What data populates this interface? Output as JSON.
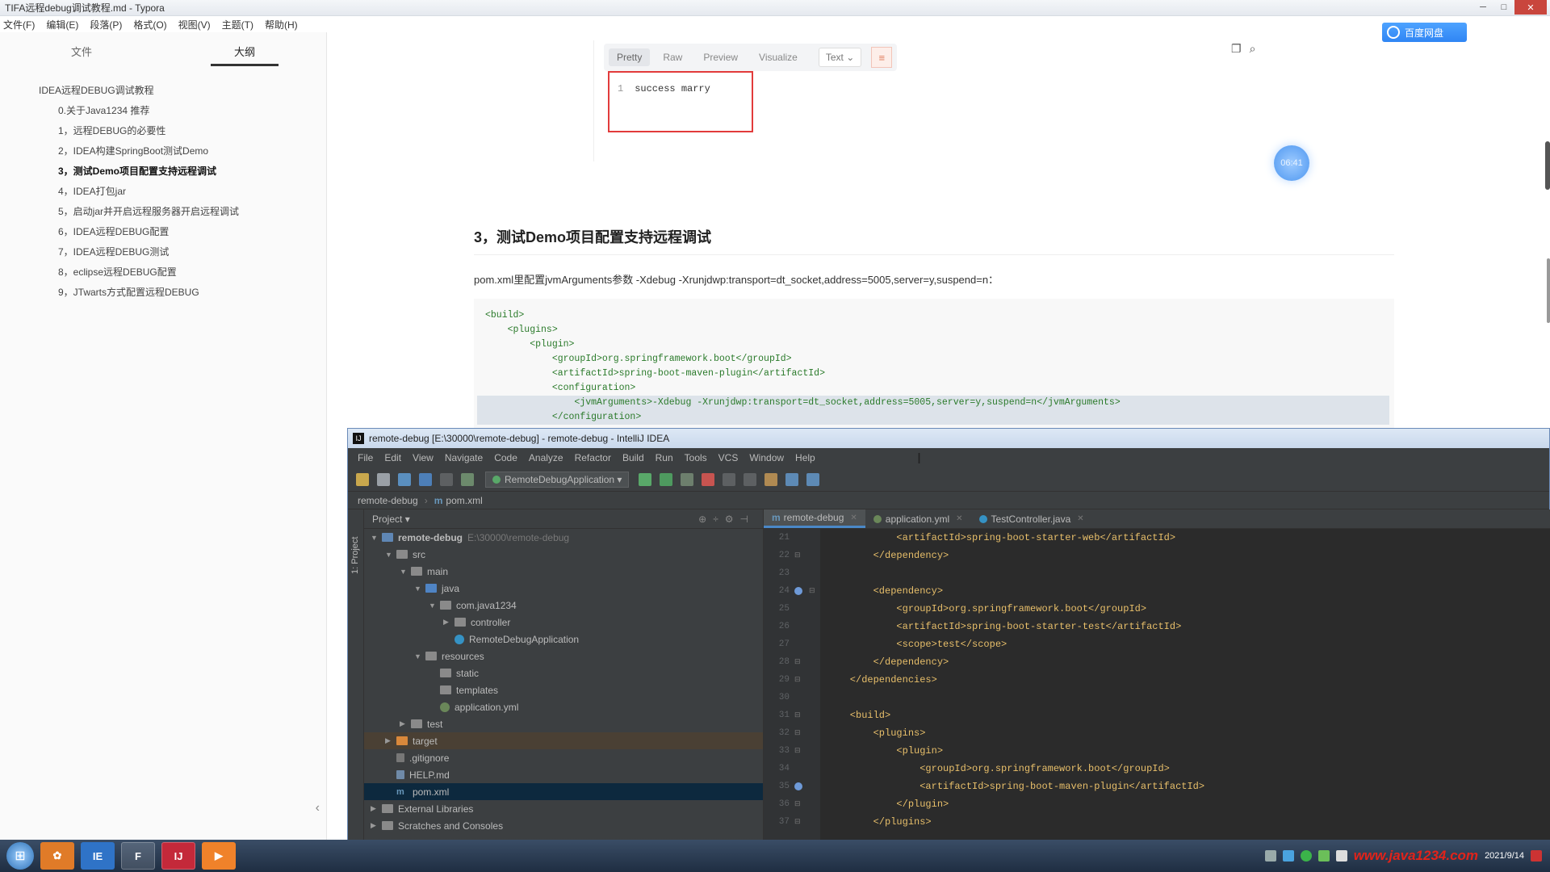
{
  "typora": {
    "title": "TIFA远程debug调试教程.md - Typora",
    "controls": {
      "minimize": "─",
      "maximize": "□",
      "close": "✕"
    },
    "menu": [
      "文件(F)",
      "编辑(E)",
      "段落(P)",
      "格式(O)",
      "视图(V)",
      "主题(T)",
      "帮助(H)"
    ],
    "sidebar": {
      "tabs": [
        "文件",
        "大纲"
      ],
      "active_tab": 1,
      "outline": [
        {
          "label": "IDEA远程DEBUG调试教程",
          "level": 0
        },
        {
          "label": "0.关于Java1234 推荐",
          "level": 1
        },
        {
          "label": "1，远程DEBUG的必要性",
          "level": 1
        },
        {
          "label": "2，IDEA构建SpringBoot测试Demo",
          "level": 1
        },
        {
          "label": "3，测试Demo项目配置支持远程调试",
          "level": 1,
          "active": true
        },
        {
          "label": "4，IDEA打包jar",
          "level": 1
        },
        {
          "label": "5，启动jar并开启远程服务器开启远程调试",
          "level": 1
        },
        {
          "label": "6，IDEA远程DEBUG配置",
          "level": 1
        },
        {
          "label": "7，IDEA远程DEBUG测试",
          "level": 1
        },
        {
          "label": "8，eclipse远程DEBUG配置",
          "level": 1
        },
        {
          "label": "9，JTwarts方式配置远程DEBUG",
          "level": 1
        }
      ],
      "collapse_icon": "‹"
    },
    "response": {
      "tabs": [
        "Pretty",
        "Raw",
        "Preview",
        "Visualize"
      ],
      "active_tab": 0,
      "format": "Text",
      "line_number": "1",
      "body": "success marry"
    },
    "float_badge": "06:41",
    "baidu_button": "百度网盘",
    "section_heading": "3，测试Demo项目配置支持远程调试",
    "paragraph": "pom.xml里配置jvmArguments参数 -Xdebug -Xrunjdwp:transport=dt_socket,address=5005,server=y,suspend=n：",
    "code_lines": [
      "<build>",
      "    <plugins>",
      "        <plugin>",
      "            <groupId>org.springframework.boot</groupId>",
      "            <artifactId>spring-boot-maven-plugin</artifactId>",
      "            <configuration>",
      "                <jvmArguments>-Xdebug -Xrunjdwp:transport=dt_socket,address=5005,server=y,suspend=n</jvmArguments>",
      "            </configuration>"
    ]
  },
  "intellij": {
    "title": "remote-debug [E:\\30000\\remote-debug] - remote-debug - IntelliJ IDEA",
    "menu": [
      "File",
      "Edit",
      "View",
      "Navigate",
      "Code",
      "Analyze",
      "Refactor",
      "Build",
      "Run",
      "Tools",
      "VCS",
      "Window",
      "Help"
    ],
    "run_config": "RemoteDebugApplication",
    "breadcrumb": [
      "remote-debug",
      "pom.xml"
    ],
    "side_stripe": "1: Project",
    "project_header": "Project",
    "tree": [
      {
        "label": "remote-debug",
        "extra": "E:\\30000\\remote-debug",
        "depth": 0,
        "arrow": "▼",
        "icon": "folder-blue",
        "bold": true
      },
      {
        "label": "src",
        "depth": 1,
        "arrow": "▼",
        "icon": "folder"
      },
      {
        "label": "main",
        "depth": 2,
        "arrow": "▼",
        "icon": "folder"
      },
      {
        "label": "java",
        "depth": 3,
        "arrow": "▼",
        "icon": "folder-src"
      },
      {
        "label": "com.java1234",
        "depth": 4,
        "arrow": "▼",
        "icon": "folder"
      },
      {
        "label": "controller",
        "depth": 5,
        "arrow": "▶",
        "icon": "folder"
      },
      {
        "label": "RemoteDebugApplication",
        "depth": 5,
        "arrow": "",
        "icon": "file-java"
      },
      {
        "label": "resources",
        "depth": 3,
        "arrow": "▼",
        "icon": "folder"
      },
      {
        "label": "static",
        "depth": 4,
        "arrow": "",
        "icon": "folder"
      },
      {
        "label": "templates",
        "depth": 4,
        "arrow": "",
        "icon": "folder"
      },
      {
        "label": "application.yml",
        "depth": 4,
        "arrow": "",
        "icon": "file-yml"
      },
      {
        "label": "test",
        "depth": 2,
        "arrow": "▶",
        "icon": "folder"
      },
      {
        "label": "target",
        "depth": 1,
        "arrow": "▶",
        "icon": "folder-orange",
        "highlight": true
      },
      {
        "label": ".gitignore",
        "depth": 1,
        "arrow": "",
        "icon": "file-git"
      },
      {
        "label": "HELP.md",
        "depth": 1,
        "arrow": "",
        "icon": "file-md"
      },
      {
        "label": "pom.xml",
        "depth": 1,
        "arrow": "",
        "icon": "file-m",
        "selected": true
      },
      {
        "label": "External Libraries",
        "depth": 0,
        "arrow": "▶",
        "icon": "folder"
      },
      {
        "label": "Scratches and Consoles",
        "depth": 0,
        "arrow": "▶",
        "icon": "folder"
      }
    ],
    "editor_tabs": [
      {
        "label": "remote-debug",
        "kind": "m",
        "active": true
      },
      {
        "label": "application.yml",
        "kind": "y"
      },
      {
        "label": "TestController.java",
        "kind": "j"
      }
    ],
    "code": [
      {
        "n": "21",
        "text": "            <artifactId>spring-boot-starter-web</artifactId>"
      },
      {
        "n": "22",
        "text": "        </dependency>",
        "fold": true
      },
      {
        "n": "23",
        "text": ""
      },
      {
        "n": "24",
        "text": "        <dependency>",
        "bulb": true,
        "fold": true
      },
      {
        "n": "25",
        "text": "            <groupId>org.springframework.boot</groupId>"
      },
      {
        "n": "26",
        "text": "            <artifactId>spring-boot-starter-test</artifactId>"
      },
      {
        "n": "27",
        "text": "            <scope>test</scope>"
      },
      {
        "n": "28",
        "text": "        </dependency>",
        "fold": true
      },
      {
        "n": "29",
        "text": "    </dependencies>",
        "fold": true
      },
      {
        "n": "30",
        "text": ""
      },
      {
        "n": "31",
        "text": "    <build>",
        "fold": true
      },
      {
        "n": "32",
        "text": "        <plugins>",
        "fold": true
      },
      {
        "n": "33",
        "text": "            <plugin>",
        "fold": true
      },
      {
        "n": "34",
        "text": "                <groupId>org.springframework.boot</groupId>"
      },
      {
        "n": "35",
        "text": "                <artifactId>spring-boot-maven-plugin</artifactId>",
        "bulb": true
      },
      {
        "n": "36",
        "text": "            </plugin>",
        "fold": true
      },
      {
        "n": "37",
        "text": "        </plugins>",
        "fold": true
      }
    ]
  },
  "taskbar": {
    "apps": [
      "IE",
      "F",
      "IJ",
      "▶"
    ],
    "watermark": "www.java1234.com",
    "clock_date": "2021/9/14"
  }
}
